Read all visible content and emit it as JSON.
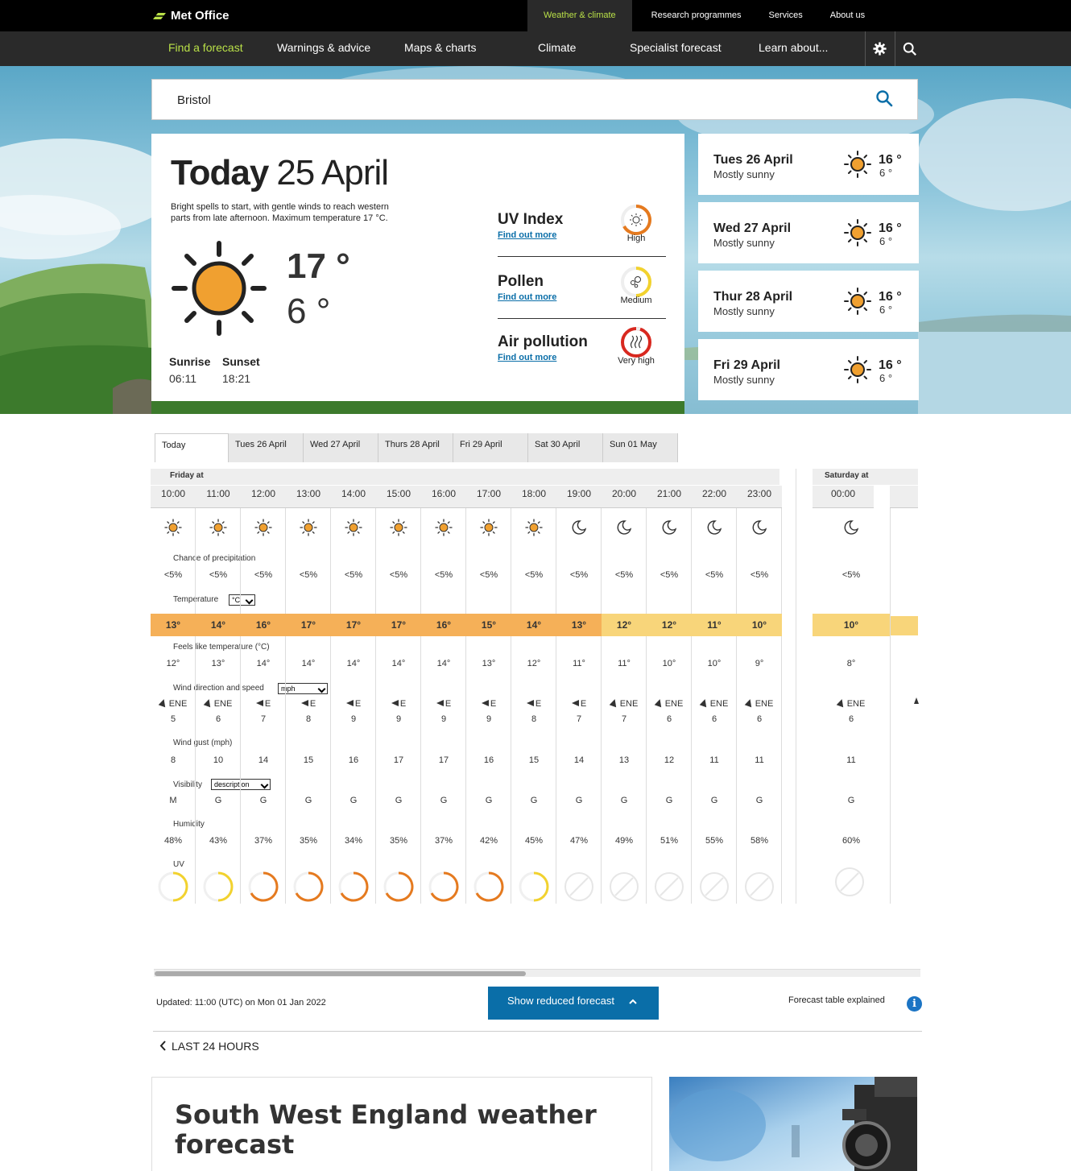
{
  "brand": {
    "name": "Met Office"
  },
  "top_links": [
    "Weather & climate",
    "Research programmes",
    "Services",
    "About us"
  ],
  "nav": {
    "items": [
      "Find a forecast",
      "Warnings & advice",
      "Maps & charts",
      "Climate",
      "Specialist forecast",
      "Learn about..."
    ],
    "icons": [
      "gear-icon",
      "search-icon"
    ]
  },
  "search": {
    "value": "Bristol"
  },
  "today": {
    "label": "Today",
    "date": "25 April",
    "description": "Bright spells to start, with gentle winds to reach western parts from late afternoon. Maximum temperature 17 °C.",
    "max": "17 °",
    "min": "6 °",
    "sunrise_label": "Sunrise",
    "sunrise": "06:11",
    "sunset_label": "Sunset",
    "sunset": "18:21"
  },
  "indices": [
    {
      "title": "UV Index",
      "link": "Find out more",
      "level": "High",
      "color": "#e57a1f"
    },
    {
      "title": "Pollen",
      "link": "Find out more",
      "level": "Medium",
      "color": "#f2d22e"
    },
    {
      "title": "Air pollution",
      "link": "Find out more",
      "level": "Very high",
      "color": "#d8281f"
    }
  ],
  "days": [
    {
      "name": "Tues 26 April",
      "desc": "Mostly sunny",
      "max": "16 °",
      "min": "6 °"
    },
    {
      "name": "Wed 27 April",
      "desc": "Mostly sunny",
      "max": "16 °",
      "min": "6 °"
    },
    {
      "name": "Thur 28 April",
      "desc": "Mostly sunny",
      "max": "16 °",
      "min": "6 °"
    },
    {
      "name": "Fri 29 April",
      "desc": "Mostly sunny",
      "max": "16 °",
      "min": "6 °"
    }
  ],
  "tabs": [
    "Today",
    "Tues 26 April",
    "Wed 27 April",
    "Thurs 28 April",
    "Fri 29 April",
    "Sat 30 April",
    "Sun 01 May"
  ],
  "groups": [
    "Friday at",
    "Saturday at"
  ],
  "rows": {
    "precip": "Chance of precipitation",
    "temp": "Temperature",
    "temp_unit": "°C",
    "feels": "Feels like temperature (°C)",
    "wind": "Wind direction and speed",
    "wind_unit": "mph",
    "gust": "Wind gust (mph)",
    "vis": "Visibility",
    "vis_mode": "description",
    "humidity": "Humidity",
    "uv": "UV"
  },
  "hours": [
    {
      "time": "10:00",
      "icon": "sun",
      "precip": "<5%",
      "temp": "13°",
      "feels": "12°",
      "dir": "ENE",
      "speed": "5",
      "gust": "8",
      "vis": "M",
      "hum": "48%",
      "uv": "medium"
    },
    {
      "time": "11:00",
      "icon": "sun",
      "precip": "<5%",
      "temp": "14°",
      "feels": "13°",
      "dir": "ENE",
      "speed": "6",
      "gust": "10",
      "vis": "G",
      "hum": "43%",
      "uv": "medium"
    },
    {
      "time": "12:00",
      "icon": "sun",
      "precip": "<5%",
      "temp": "16°",
      "feels": "14°",
      "dir": "E",
      "speed": "7",
      "gust": "14",
      "vis": "G",
      "hum": "37%",
      "uv": "high"
    },
    {
      "time": "13:00",
      "icon": "sun",
      "precip": "<5%",
      "temp": "17°",
      "feels": "14°",
      "dir": "E",
      "speed": "8",
      "gust": "15",
      "vis": "G",
      "hum": "35%",
      "uv": "high"
    },
    {
      "time": "14:00",
      "icon": "sun",
      "precip": "<5%",
      "temp": "17°",
      "feels": "14°",
      "dir": "E",
      "speed": "9",
      "gust": "16",
      "vis": "G",
      "hum": "34%",
      "uv": "high"
    },
    {
      "time": "15:00",
      "icon": "sun",
      "precip": "<5%",
      "temp": "17°",
      "feels": "14°",
      "dir": "E",
      "speed": "9",
      "gust": "17",
      "vis": "G",
      "hum": "35%",
      "uv": "high"
    },
    {
      "time": "16:00",
      "icon": "sun",
      "precip": "<5%",
      "temp": "16°",
      "feels": "14°",
      "dir": "E",
      "speed": "9",
      "gust": "17",
      "vis": "G",
      "hum": "37%",
      "uv": "high"
    },
    {
      "time": "17:00",
      "icon": "sun",
      "precip": "<5%",
      "temp": "15°",
      "feels": "13°",
      "dir": "E",
      "speed": "9",
      "gust": "16",
      "vis": "G",
      "hum": "42%",
      "uv": "high"
    },
    {
      "time": "18:00",
      "icon": "sun",
      "precip": "<5%",
      "temp": "14°",
      "feels": "12°",
      "dir": "E",
      "speed": "8",
      "gust": "15",
      "vis": "G",
      "hum": "45%",
      "uv": "medium"
    },
    {
      "time": "19:00",
      "icon": "moon",
      "precip": "<5%",
      "temp": "13°",
      "feels": "11°",
      "dir": "E",
      "speed": "7",
      "gust": "14",
      "vis": "G",
      "hum": "47%",
      "uv": "none"
    },
    {
      "time": "20:00",
      "icon": "moon",
      "precip": "<5%",
      "temp": "12°",
      "feels": "11°",
      "dir": "ENE",
      "speed": "7",
      "gust": "13",
      "vis": "G",
      "hum": "49%",
      "uv": "none"
    },
    {
      "time": "21:00",
      "icon": "moon",
      "precip": "<5%",
      "temp": "12°",
      "feels": "10°",
      "dir": "ENE",
      "speed": "6",
      "gust": "12",
      "vis": "G",
      "hum": "51%",
      "uv": "none"
    },
    {
      "time": "22:00",
      "icon": "moon",
      "precip": "<5%",
      "temp": "11°",
      "feels": "10°",
      "dir": "ENE",
      "speed": "6",
      "gust": "11",
      "vis": "G",
      "hum": "55%",
      "uv": "none"
    },
    {
      "time": "23:00",
      "icon": "moon",
      "precip": "<5%",
      "temp": "10°",
      "feels": "9°",
      "dir": "ENE",
      "speed": "6",
      "gust": "11",
      "vis": "G",
      "hum": "58%",
      "uv": "none"
    },
    {
      "time": "00:00",
      "icon": "moon",
      "precip": "<5%",
      "temp": "10°",
      "feels": "8°",
      "dir": "ENE",
      "speed": "6",
      "gust": "11",
      "vis": "G",
      "hum": "60%",
      "uv": "none"
    }
  ],
  "footer": {
    "updated": "Updated: 11:00 (UTC) on Mon 01 Jan 2022",
    "show_btn": "Show reduced forecast",
    "explained": "Forecast table explained",
    "info": "i",
    "last24": "LAST 24 HOURS"
  },
  "regional": {
    "title": "South West England weather forecast"
  },
  "colors": {
    "accent": "#b9e048",
    "link": "#0a6ea8",
    "sun": "#f0a030"
  }
}
